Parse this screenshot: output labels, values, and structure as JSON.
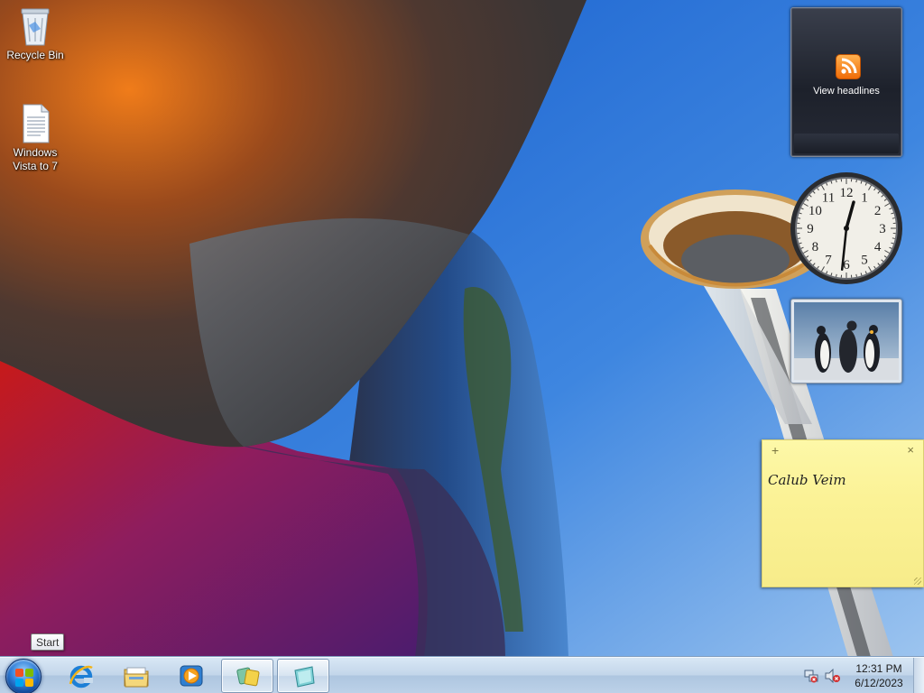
{
  "desktop": {
    "icons": [
      {
        "label": "Recycle Bin",
        "icon": "recycle-bin-icon"
      },
      {
        "label": "Windows Vista to 7",
        "icon": "text-file-icon"
      }
    ]
  },
  "gadgets": {
    "feed": {
      "caption": "View headlines",
      "icon": "rss-icon"
    },
    "clock": {
      "hour_numbers": [
        "12",
        "1",
        "2",
        "3",
        "4",
        "5",
        "6",
        "7",
        "8",
        "9",
        "10",
        "11"
      ],
      "time_shown": "12:31"
    },
    "slideshow": {
      "icon": "penguins-photo"
    },
    "sticky_note": {
      "add_label": "+",
      "close_label": "×",
      "text": "Calub Veim"
    }
  },
  "tooltip": {
    "text": "Start"
  },
  "taskbar": {
    "pinned": [
      {
        "name": "internet-explorer",
        "icon": "ie-icon",
        "active": false
      },
      {
        "name": "windows-explorer",
        "icon": "folder-icon",
        "active": false
      },
      {
        "name": "windows-media-player",
        "icon": "media-player-icon",
        "active": false
      },
      {
        "name": "windows-gadgets",
        "icon": "gadgets-icon",
        "active": true
      },
      {
        "name": "sticky-notes",
        "icon": "sticky-notes-icon",
        "active": true
      }
    ],
    "tray": {
      "time": "12:31 PM",
      "date": "6/12/2023",
      "icons": [
        "network-icon",
        "volume-muted-icon"
      ]
    }
  },
  "colors": {
    "sky": "#2d6fd0",
    "taskbar": "#c3d6ea",
    "sticky": "#fbf296",
    "rss": "#f58a1f"
  }
}
